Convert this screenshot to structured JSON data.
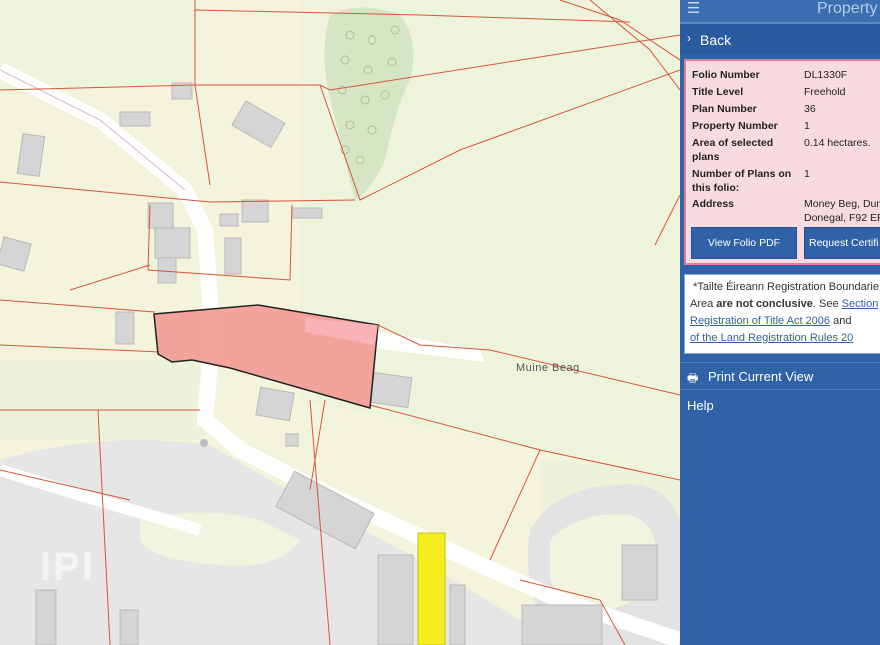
{
  "map": {
    "place_label": "Muine Beag",
    "watermark": "IPI"
  },
  "panel": {
    "title": "Property",
    "back_label": "Back",
    "folio": {
      "rows": [
        {
          "key": "Folio Number",
          "value": "DL1330F"
        },
        {
          "key": "Title Level",
          "value": "Freehold"
        },
        {
          "key": "Plan Number",
          "value": "36"
        },
        {
          "key": "Property Number",
          "value": "1"
        },
        {
          "key": "Area of selected plans",
          "value": "0.14 hectares."
        },
        {
          "key": "Number of Plans on this folio:",
          "value": "1"
        },
        {
          "key": "Address",
          "value": "Money Beg, Dun",
          "value2": "Donegal, F92 EP"
        }
      ],
      "view_pdf_label": "View Folio PDF",
      "request_cert_label": "Request Certifi"
    },
    "disclaimer": {
      "line1": "*Tailte Éireann Registration Boundarie",
      "line2_pre": "Area ",
      "line2_bold": "are not conclusive",
      "line2_post": ". See ",
      "link1": "Section",
      "link2": "Registration of Title Act 2006",
      "line3_post": " and",
      "link3": "of the Land Registration Rules 20"
    },
    "print_label": "Print Current View",
    "help_label": "Help"
  },
  "colors": {
    "panel_bg": "#2f62a6",
    "selected_parcel": "#f2837d",
    "highlight": "#f4ee1e",
    "boundary": "#d9553a"
  }
}
